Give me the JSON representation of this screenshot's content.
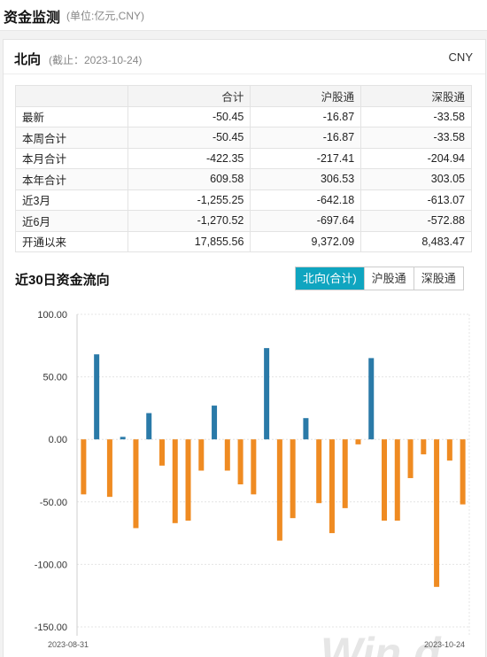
{
  "header": {
    "title": "资金监测",
    "unit": "(单位:亿元,CNY)"
  },
  "northbound": {
    "title": "北向",
    "date": "(截止：2023-10-24)",
    "currency": "CNY",
    "columns": [
      "",
      "合计",
      "沪股通",
      "深股通"
    ],
    "rows": [
      {
        "label": "最新",
        "values": [
          "-50.45",
          "-16.87",
          "-33.58"
        ]
      },
      {
        "label": "本周合计",
        "values": [
          "-50.45",
          "-16.87",
          "-33.58"
        ]
      },
      {
        "label": "本月合计",
        "values": [
          "-422.35",
          "-217.41",
          "-204.94"
        ]
      },
      {
        "label": "本年合计",
        "values": [
          "609.58",
          "306.53",
          "303.05"
        ]
      },
      {
        "label": "近3月",
        "values": [
          "-1,255.25",
          "-642.18",
          "-613.07"
        ]
      },
      {
        "label": "近6月",
        "values": [
          "-1,270.52",
          "-697.64",
          "-572.88"
        ]
      },
      {
        "label": "开通以来",
        "values": [
          "17,855.56",
          "9,372.09",
          "8,483.47"
        ]
      }
    ]
  },
  "flow30": {
    "title": "近30日资金流向",
    "tabs": [
      "北向(合计)",
      "沪股通",
      "深股通"
    ],
    "active_tab": 0
  },
  "watermark": "Win.d",
  "chart_data": {
    "type": "bar",
    "title": "",
    "xlabel": "",
    "ylabel": "",
    "ylim": [
      -150,
      100
    ],
    "yticks": [
      "100.00",
      "50.00",
      "0.00",
      "-50.00",
      "-100.00",
      "-150.00"
    ],
    "ytick_values": [
      100,
      50,
      0,
      -50,
      -100,
      -150
    ],
    "x_first_label": "2023-08-31",
    "x_last_label": "2023-10-24",
    "grid": true,
    "colors": {
      "positive": "#2a7aa8",
      "negative": "#ef8b22"
    },
    "values": [
      -44,
      68,
      -46,
      2,
      -71,
      21,
      -21,
      -67,
      -65,
      -25,
      27,
      -25,
      -36,
      -44,
      73,
      -81,
      -63,
      17,
      -51,
      -75,
      -55,
      -4,
      65,
      -65,
      -65,
      -31,
      -12,
      -118,
      -17,
      -52
    ]
  }
}
